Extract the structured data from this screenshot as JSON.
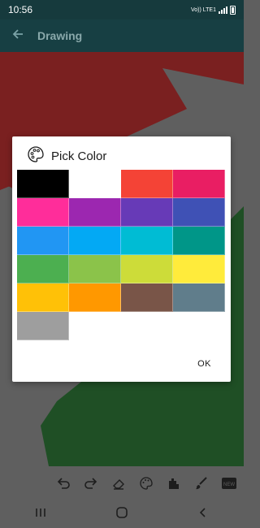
{
  "status": {
    "time": "10:56",
    "network_label": "Vo)) LTE1"
  },
  "app_bar": {
    "title": "Drawing",
    "back_icon": "arrow-back-icon"
  },
  "dialog": {
    "title": "Pick Color",
    "icon": "palette-icon",
    "ok_label": "OK",
    "swatches": [
      {
        "color": "#000000"
      },
      {
        "color": "#ffffff"
      },
      {
        "color": "#f44336"
      },
      {
        "color": "#e91e63"
      },
      {
        "color": "#ff2d9a"
      },
      {
        "color": "#9c27b0"
      },
      {
        "color": "#673ab7"
      },
      {
        "color": "#3f51b5"
      },
      {
        "color": "#2196f3"
      },
      {
        "color": "#03a9f4"
      },
      {
        "color": "#00bcd4"
      },
      {
        "color": "#009688"
      },
      {
        "color": "#4caf50"
      },
      {
        "color": "#8bc34a"
      },
      {
        "color": "#cddc39"
      },
      {
        "color": "#ffeb3b"
      },
      {
        "color": "#ffc107"
      },
      {
        "color": "#ff9800"
      },
      {
        "color": "#795548"
      },
      {
        "color": "#607d8b"
      },
      {
        "color": "#9e9e9e"
      }
    ]
  },
  "toolbar": {
    "tools": [
      "undo-icon",
      "redo-icon",
      "eraser-icon",
      "palette-icon",
      "fill-icon",
      "brush-icon",
      "new-canvas-icon"
    ],
    "new_label": "NEW"
  },
  "colors": {
    "canvas_red": "#7a2020",
    "canvas_green": "#1f4f25",
    "scrim": "#5f5f5f"
  }
}
